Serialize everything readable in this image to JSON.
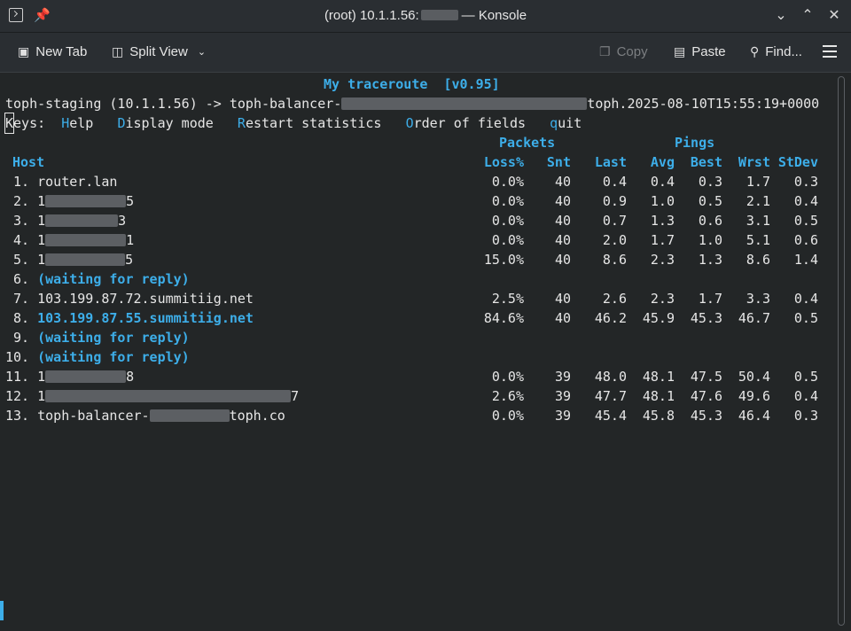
{
  "window": {
    "title_prefix": "(root) 10.1.1.56:",
    "title_suffix": "— Konsole",
    "icons": {
      "app": "terminal-icon",
      "pin": "pin-icon",
      "min": "chevron-down-icon",
      "max": "chevron-up-icon",
      "close": "close-icon"
    }
  },
  "toolbar": {
    "new_tab": "New Tab",
    "split_view": "Split View",
    "copy": "Copy",
    "paste": "Paste",
    "find": "Find..."
  },
  "terminal": {
    "program_title": "My traceroute  [v0.95]",
    "route_left": "toph-staging (10.1.1.56) -> toph-balancer-",
    "route_right": "toph.2025-08-10T15:55:19+0000",
    "keys_label": "eys:",
    "keys_first": "K",
    "keys": [
      {
        "hot": "H",
        "rest": "elp"
      },
      {
        "hot": "D",
        "rest": "isplay mode"
      },
      {
        "hot": "R",
        "rest": "estart statistics"
      },
      {
        "hot": "O",
        "rest": "rder of fields"
      },
      {
        "hot": "q",
        "rest": "uit"
      }
    ],
    "group_packets": "Packets",
    "group_pings": "Pings",
    "headers": {
      "host": "Host",
      "loss": "Loss%",
      "snt": "Snt",
      "last": "Last",
      "avg": "Avg",
      "best": "Best",
      "wrst": "Wrst",
      "stdev": "StDev"
    },
    "rows": [
      {
        "num": " 1.",
        "host": "router.lan",
        "loss": "0.0%",
        "snt": "40",
        "last": "0.4",
        "avg": "0.4",
        "best": "0.3",
        "wrst": "1.7",
        "stdev": "0.3"
      },
      {
        "num": " 2.",
        "host": "1",
        "host_end": "5",
        "loss": "0.0%",
        "snt": "40",
        "last": "0.9",
        "avg": "1.0",
        "best": "0.5",
        "wrst": "2.1",
        "stdev": "0.4"
      },
      {
        "num": " 3.",
        "host": "1",
        "host_end": "3",
        "loss": "0.0%",
        "snt": "40",
        "last": "0.7",
        "avg": "1.3",
        "best": "0.6",
        "wrst": "3.1",
        "stdev": "0.5"
      },
      {
        "num": " 4.",
        "host": "1",
        "host_end": "1",
        "loss": "0.0%",
        "snt": "40",
        "last": "2.0",
        "avg": "1.7",
        "best": "1.0",
        "wrst": "5.1",
        "stdev": "0.6"
      },
      {
        "num": " 5.",
        "host": "1",
        "host_end": "5",
        "loss": "15.0%",
        "snt": "40",
        "last": "8.6",
        "avg": "2.3",
        "best": "1.3",
        "wrst": "8.6",
        "stdev": "1.4"
      },
      {
        "num": " 6.",
        "host": "(waiting for reply)",
        "waiting": true
      },
      {
        "num": " 7.",
        "host": "103.199.87.72.summitiig.net",
        "loss": "2.5%",
        "snt": "40",
        "last": "2.6",
        "avg": "2.3",
        "best": "1.7",
        "wrst": "3.3",
        "stdev": "0.4"
      },
      {
        "num": " 8.",
        "host": "103.199.87.55.summitiig.net",
        "highlight": true,
        "loss": "84.6%",
        "snt": "40",
        "last": "46.2",
        "avg": "45.9",
        "best": "45.3",
        "wrst": "46.7",
        "stdev": "0.5"
      },
      {
        "num": " 9.",
        "host": "(waiting for reply)",
        "waiting": true
      },
      {
        "num": "10.",
        "host": "(waiting for reply)",
        "waiting": true
      },
      {
        "num": "11.",
        "host": "1",
        "host_end": "8",
        "loss": "0.0%",
        "snt": "39",
        "last": "48.0",
        "avg": "48.1",
        "best": "47.5",
        "wrst": "50.4",
        "stdev": "0.5"
      },
      {
        "num": "12.",
        "host": "1",
        "host_end": "7",
        "loss": "2.6%",
        "snt": "39",
        "last": "47.7",
        "avg": "48.1",
        "best": "47.6",
        "wrst": "49.6",
        "stdev": "0.4"
      },
      {
        "num": "13.",
        "host": "toph-balancer-",
        "host_end": "toph.co",
        "loss": "0.0%",
        "snt": "39",
        "last": "45.4",
        "avg": "45.8",
        "best": "45.3",
        "wrst": "46.4",
        "stdev": "0.3"
      }
    ]
  },
  "colors": {
    "accent": "#3daee9",
    "background": "#232627",
    "text": "#e6e6e6"
  }
}
